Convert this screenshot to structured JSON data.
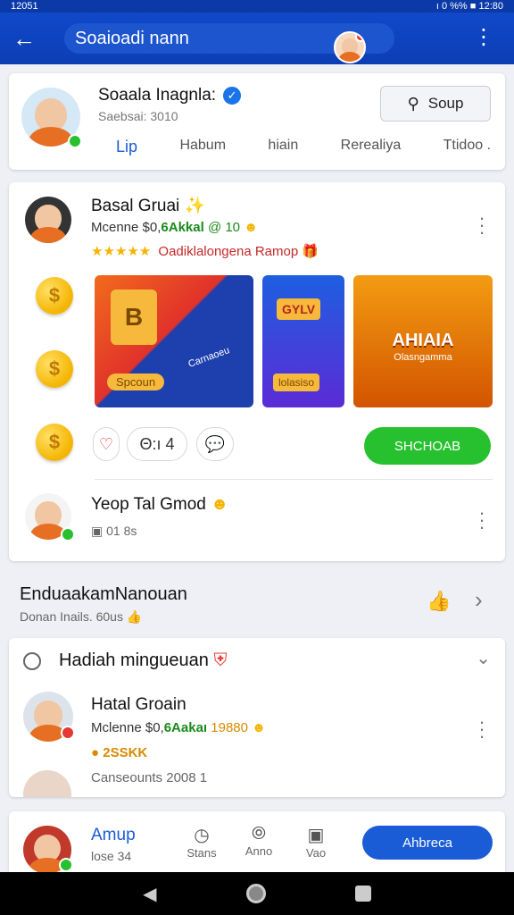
{
  "status_bar": {
    "left": "12051",
    "right": "ı 0 %% ■ 12:80"
  },
  "app_bar": {
    "search_text": "Soaioadi nann"
  },
  "profile": {
    "name": "Soaala Inagnla:",
    "subtitle": "Saebsai: 3010",
    "tabs": [
      "Lip",
      "Habum",
      "hiain",
      "Rerealiya",
      "Ttidoo ."
    ],
    "action_label": "Soup"
  },
  "post": {
    "author": "Basal Gruai",
    "star_emoji": "✨",
    "meta_prefix": "Mcenne $0,",
    "meta_amount": "6Akkal",
    "meta_suffix": "@ 10",
    "rating_stars": "★★★★★",
    "rating_text": "Oadiklalongena Ramop",
    "tile1_text": "Spcoun",
    "tile1_icon": "B",
    "tile1_label": "Carnaoeu",
    "tile2_top": "GYLV",
    "tile2_label": "lolasiso",
    "tile3_title": "AHIAIA",
    "tile3_sub": "Olasngamma",
    "pill_count": "Θ:ı 4",
    "action_button": "SHCHOAB"
  },
  "comment": {
    "name": "Yeop Tal Gmod",
    "meta": "01 8s"
  },
  "section": {
    "title": "EnduaakamNanouan",
    "subtitle": "Donan Inails. 60us"
  },
  "weekly": {
    "title": "Hadiah mingueuan",
    "item_name": "Hatal Groain",
    "item_meta_prefix": "Mclenne $0,",
    "item_meta_amount": "6Aakaı",
    "item_meta_suffix": "19880",
    "coins": "2SSKK",
    "footer": "Canseounts 2008 1"
  },
  "bottom_bar": {
    "name": "Amup",
    "meta": "lose 34",
    "tab1": "Stans",
    "tab2": "Anno",
    "tab3": "Vao",
    "cta": "Ahbreca"
  },
  "colors": {
    "primary": "#0c3db5",
    "green": "#27c12f",
    "accent_blue": "#1a5bd6",
    "coin": "#f4b400"
  }
}
